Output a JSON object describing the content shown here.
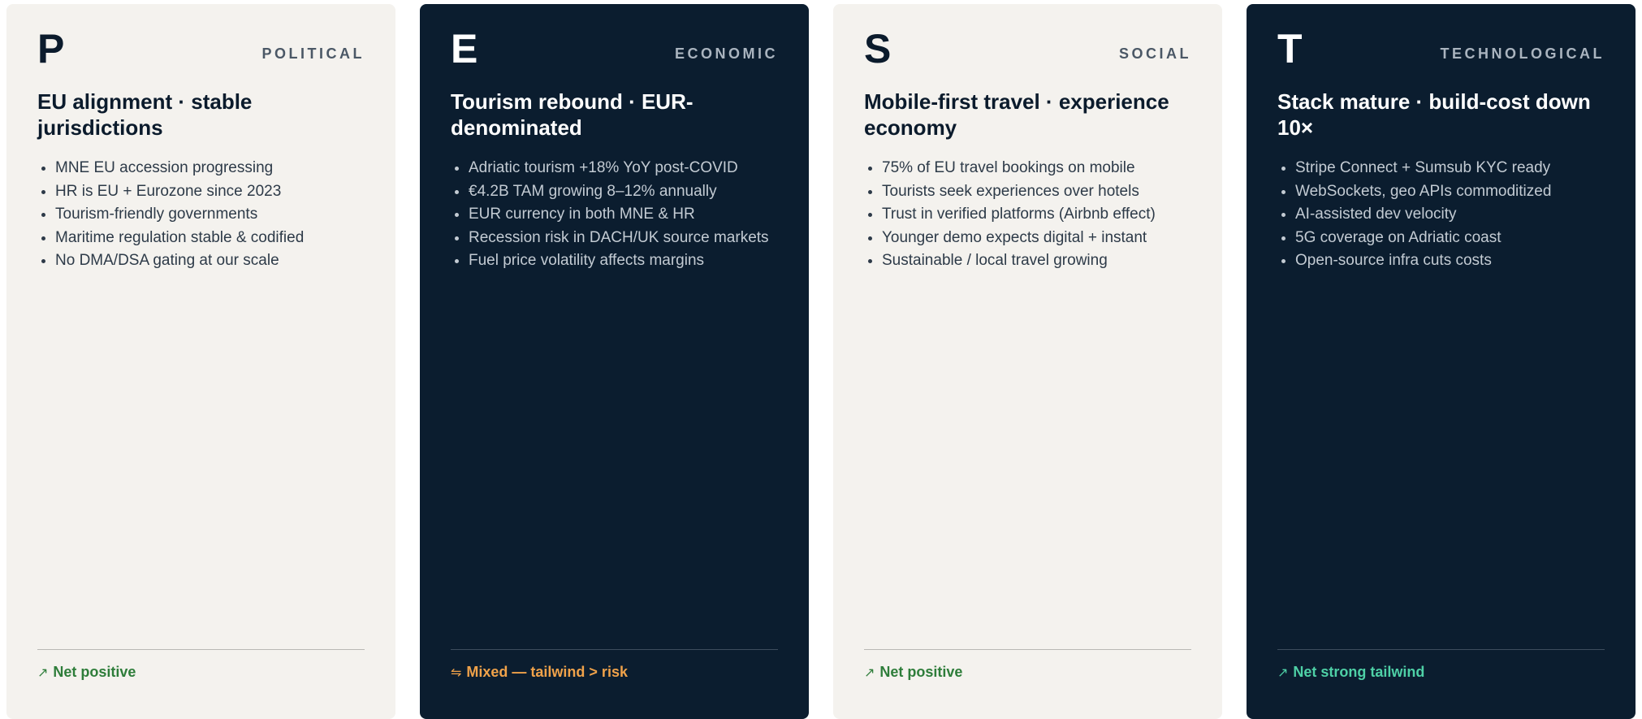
{
  "cards": [
    {
      "letter": "P",
      "label": "POLITICAL",
      "title": "EU alignment · stable jurisdictions",
      "bullets": [
        "MNE EU accession progressing",
        "HR is EU + Eurozone since 2023",
        "Tourism-friendly governments",
        "Maritime regulation stable & codified",
        "No DMA/DSA gating at our scale"
      ],
      "verdict_icon": "↗",
      "verdict": "Net positive",
      "verdict_color": "#2e7d3a"
    },
    {
      "letter": "E",
      "label": "ECONOMIC",
      "title": "Tourism rebound · EUR-denominated",
      "bullets": [
        "Adriatic tourism +18% YoY post-COVID",
        "€4.2B TAM growing 8–12% annually",
        "EUR currency in both MNE & HR",
        "Recession risk in DACH/UK source markets",
        "Fuel price volatility affects margins"
      ],
      "verdict_icon": "⇋",
      "verdict": "Mixed — tailwind > risk",
      "verdict_color": "#f0a24a"
    },
    {
      "letter": "S",
      "label": "SOCIAL",
      "title": "Mobile-first travel · experience economy",
      "bullets": [
        "75% of EU travel bookings on mobile",
        "Tourists seek experiences over hotels",
        "Trust in verified platforms (Airbnb effect)",
        "Younger demo expects digital + instant",
        "Sustainable / local travel growing"
      ],
      "verdict_icon": "↗",
      "verdict": "Net positive",
      "verdict_color": "#2e7d3a"
    },
    {
      "letter": "T",
      "label": "TECHNOLOGICAL",
      "title": "Stack mature · build-cost down 10×",
      "bullets": [
        "Stripe Connect + Sumsub KYC ready",
        "WebSockets, geo APIs commoditized",
        "AI-assisted dev velocity",
        "5G coverage on Adriatic coast",
        "Open-source infra cuts costs"
      ],
      "verdict_icon": "↗",
      "verdict": "Net strong tailwind",
      "verdict_color": "#4ed0a6"
    }
  ]
}
